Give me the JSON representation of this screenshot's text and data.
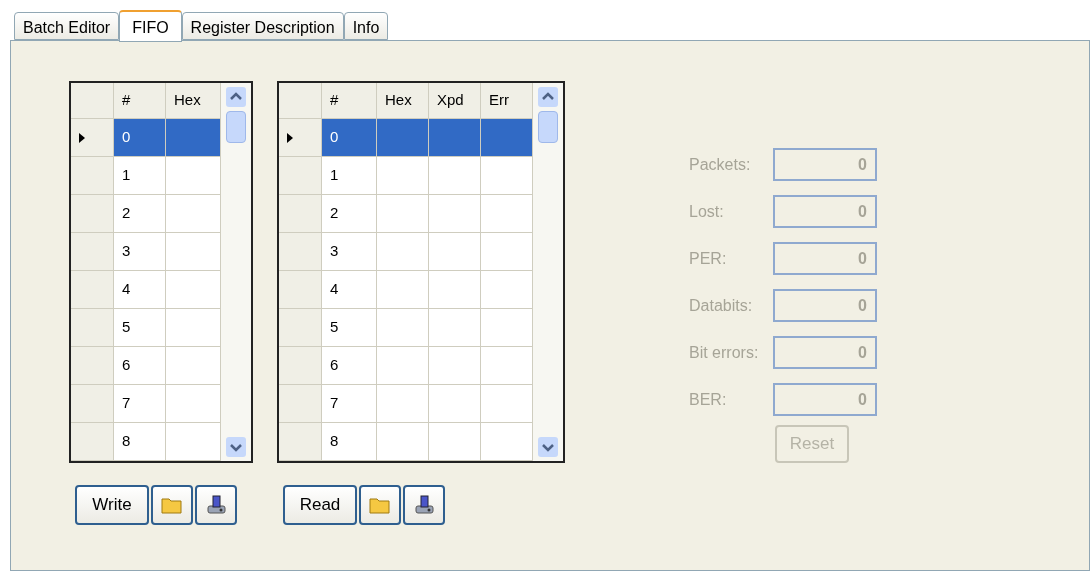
{
  "tabs": [
    {
      "label": "Batch Editor",
      "selected": false
    },
    {
      "label": "FIFO",
      "selected": true
    },
    {
      "label": "Register Description",
      "selected": false
    },
    {
      "label": "Info",
      "selected": false
    }
  ],
  "write_grid": {
    "columns": [
      "#",
      "Hex"
    ],
    "rows": [
      {
        "cells": [
          "0",
          ""
        ],
        "selected": true
      },
      {
        "cells": [
          "1",
          ""
        ],
        "selected": false
      },
      {
        "cells": [
          "2",
          ""
        ],
        "selected": false
      },
      {
        "cells": [
          "3",
          ""
        ],
        "selected": false
      },
      {
        "cells": [
          "4",
          ""
        ],
        "selected": false
      },
      {
        "cells": [
          "5",
          ""
        ],
        "selected": false
      },
      {
        "cells": [
          "6",
          ""
        ],
        "selected": false
      },
      {
        "cells": [
          "7",
          ""
        ],
        "selected": false
      },
      {
        "cells": [
          "8",
          ""
        ],
        "selected": false
      }
    ],
    "button": "Write"
  },
  "read_grid": {
    "columns": [
      "#",
      "Hex",
      "Xpd",
      "Err"
    ],
    "rows": [
      {
        "cells": [
          "0",
          "",
          "",
          ""
        ],
        "selected": true
      },
      {
        "cells": [
          "1",
          "",
          "",
          ""
        ],
        "selected": false
      },
      {
        "cells": [
          "2",
          "",
          "",
          ""
        ],
        "selected": false
      },
      {
        "cells": [
          "3",
          "",
          "",
          ""
        ],
        "selected": false
      },
      {
        "cells": [
          "4",
          "",
          "",
          ""
        ],
        "selected": false
      },
      {
        "cells": [
          "5",
          "",
          "",
          ""
        ],
        "selected": false
      },
      {
        "cells": [
          "6",
          "",
          "",
          ""
        ],
        "selected": false
      },
      {
        "cells": [
          "7",
          "",
          "",
          ""
        ],
        "selected": false
      },
      {
        "cells": [
          "8",
          "",
          "",
          ""
        ],
        "selected": false
      }
    ],
    "button": "Read"
  },
  "stats": {
    "disabled": true,
    "fields": [
      {
        "label": "Packets:",
        "value": "0"
      },
      {
        "label": "Lost:",
        "value": "0"
      },
      {
        "label": "PER:",
        "value": "0"
      },
      {
        "label": "Databits:",
        "value": "0"
      },
      {
        "label": "Bit errors:",
        "value": "0"
      },
      {
        "label": "BER:",
        "value": "0"
      }
    ],
    "reset": "Reset"
  }
}
